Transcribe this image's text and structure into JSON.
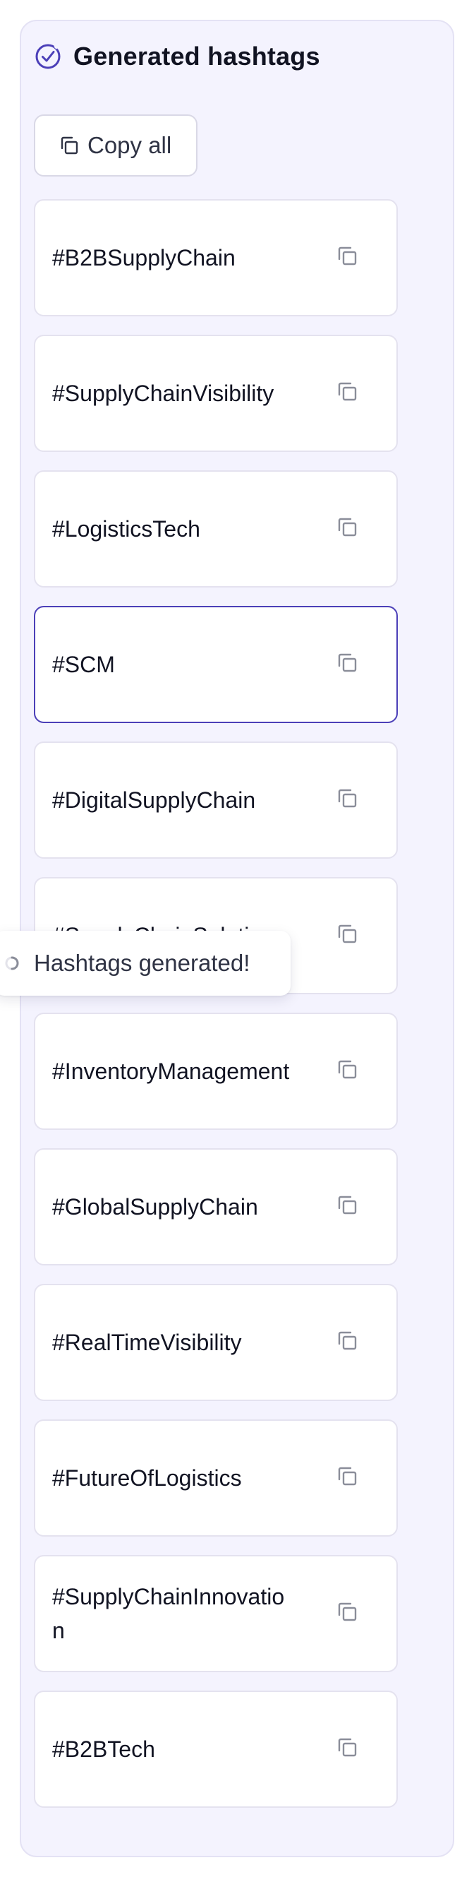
{
  "header": {
    "title": "Generated hashtags",
    "icon": "check-circle-icon",
    "accent_color": "#4b3fb8"
  },
  "toolbar": {
    "copy_all_label": "Copy all",
    "copy_all_icon": "copy-icon"
  },
  "hashtags": [
    {
      "text": "#B2BSupplyChain",
      "selected": false
    },
    {
      "text": "#SupplyChainVisibility",
      "selected": false
    },
    {
      "text": "#LogisticsTech",
      "selected": false
    },
    {
      "text": "#SCM",
      "selected": true
    },
    {
      "text": "#DigitalSupplyChain",
      "selected": false
    },
    {
      "text": "#SupplyChainSolution",
      "selected": false
    },
    {
      "text": "#InventoryManagement",
      "selected": false
    },
    {
      "text": "#GlobalSupplyChain",
      "selected": false
    },
    {
      "text": "#RealTimeVisibility",
      "selected": false
    },
    {
      "text": "#FutureOfLogistics",
      "selected": false
    },
    {
      "text": "#SupplyChainInnovation",
      "selected": false
    },
    {
      "text": "#B2BTech",
      "selected": false
    }
  ],
  "toast": {
    "message": "Hashtags generated!",
    "icon": "spinner-icon"
  },
  "colors": {
    "panel_bg": "#f4f3fe",
    "selected_border": "#4b3fb8",
    "icon_gray": "#8a8d99"
  }
}
